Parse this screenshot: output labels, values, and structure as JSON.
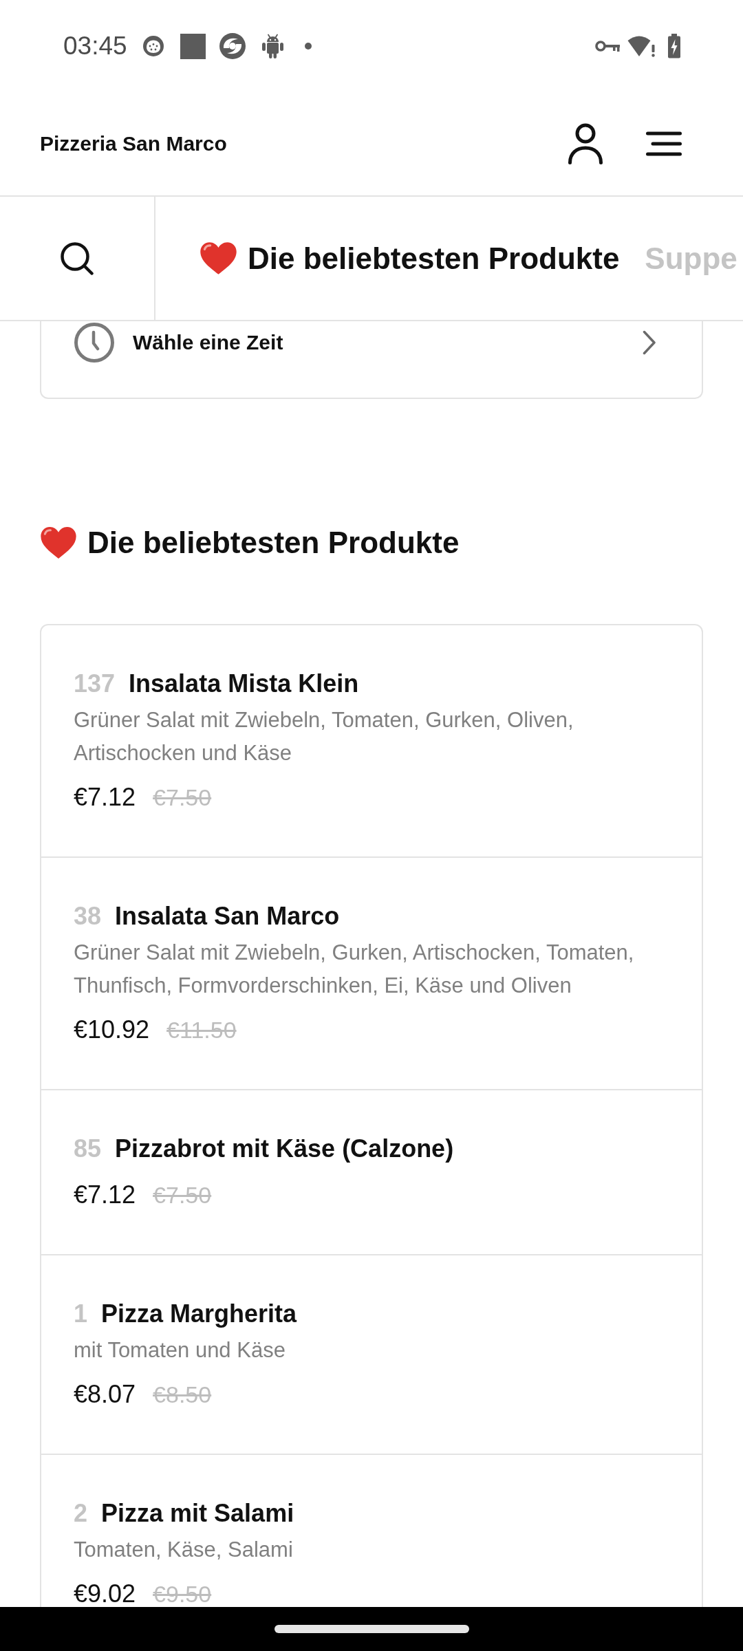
{
  "status_bar": {
    "time": "03:45"
  },
  "header": {
    "title": "Pizzeria San Marco"
  },
  "category_tabs": [
    {
      "label": "Die beliebtesten Produkte",
      "kind": "favorites",
      "selected": true
    },
    {
      "label": "Suppe",
      "kind": "category",
      "selected": false
    }
  ],
  "time_picker": {
    "label": "Wähle eine Zeit"
  },
  "sections": [
    {
      "kind": "favorites",
      "title": "Die beliebtesten Produkte",
      "products": [
        {
          "number": "137",
          "name": "Insalata Mista Klein",
          "description": "Grüner Salat mit Zwiebeln, Tomaten, Gurken, Oliven, Artischocken und Käse",
          "price": "€7.12",
          "original_price": "€7.50"
        },
        {
          "number": "38",
          "name": "Insalata San Marco",
          "description": "Grüner Salat mit Zwiebeln, Gurken, Artischocken, Tomaten, Thunfisch, Formvorderschinken, Ei, Käse und Oliven",
          "price": "€10.92",
          "original_price": "€11.50"
        },
        {
          "number": "85",
          "name": "Pizzabrot mit Käse (Calzone)",
          "price": "€7.12",
          "original_price": "€7.50"
        },
        {
          "number": "1",
          "name": "Pizza Margherita",
          "description": "mit Tomaten und Käse",
          "price": "€8.07",
          "original_price": "€8.50"
        },
        {
          "number": "2",
          "name": "Pizza mit Salami",
          "description": "Tomaten, Käse, Salami",
          "price": "€9.02",
          "original_price": "€9.50"
        }
      ]
    }
  ]
}
